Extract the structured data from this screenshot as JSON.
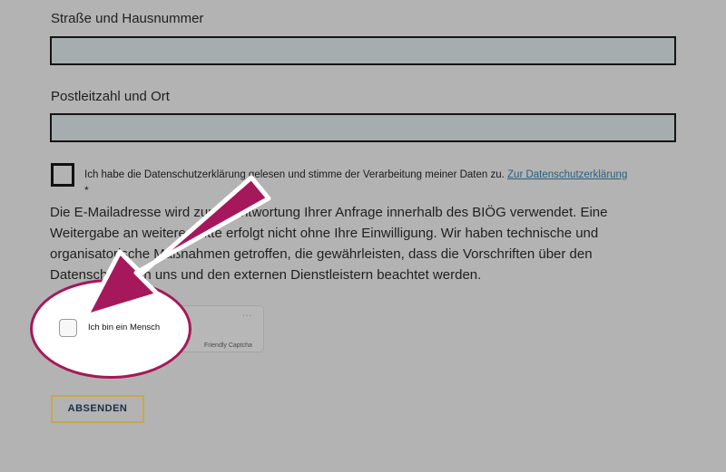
{
  "form": {
    "street_label": "Straße und Hausnummer",
    "street_value": "",
    "city_label": "Postleitzahl und Ort",
    "city_value": "",
    "consent": {
      "text": "Ich habe die Datenschutzerklärung gelesen und stimme der Verarbeitung meiner Daten zu.",
      "link": "Zur Datenschutzerklärung",
      "required_mark": "*",
      "checked": false
    },
    "info_text": "Die E-Mailadresse wird zur Beantwortung Ihrer Anfrage innerhalb des BIÖG verwendet. Eine Weitergabe an weitere Dritte erfolgt nicht ohne Ihre Einwilligung. Wir haben technische und organisatorische Maßnahmen getroffen, die gewährleisten, dass die Vorschriften über den Datenschutz von uns und den externen Dienstleistern beachtet werden.",
    "submit_label": "ABSENDEN"
  },
  "captcha": {
    "label": "Ich bin ein Mensch",
    "brand": "Friendly Captcha",
    "menu": "...",
    "checked": false
  },
  "overlay": {
    "highlight_color": "#a5185b"
  }
}
